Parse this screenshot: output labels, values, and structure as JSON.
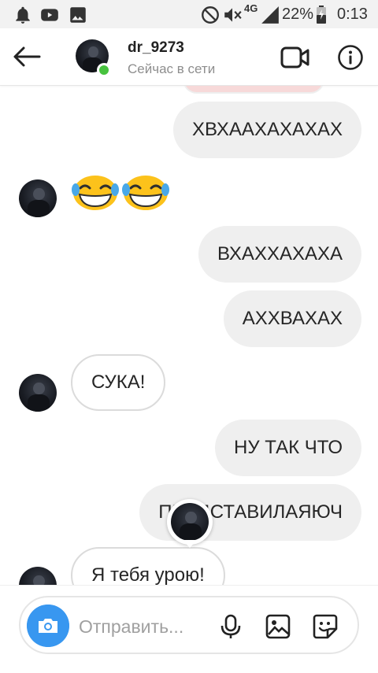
{
  "status_bar": {
    "network": "4G",
    "battery": "22%",
    "time": "0:13"
  },
  "header": {
    "username": "dr_9273",
    "presence": "Сейчас в сети"
  },
  "messages": [
    {
      "side": "out",
      "text": "ХВХААХАХАХАХ"
    },
    {
      "side": "in",
      "type": "emoji",
      "emoji": "😂😂"
    },
    {
      "side": "out",
      "text": "ВХАХХАХАХА"
    },
    {
      "side": "out",
      "text": "АХХВАХАХ"
    },
    {
      "side": "in",
      "text": "СУКА!"
    },
    {
      "side": "out",
      "text": "НУ ТАК ЧТО"
    },
    {
      "side": "out",
      "text": "ПРЕДСТАВИЛАЯЮЧ"
    },
    {
      "side": "in",
      "text": "Я тебя урою!"
    }
  ],
  "composer": {
    "placeholder": "Отправить..."
  },
  "colors": {
    "accent": "#3897f0",
    "online": "#47c23e",
    "bubble_out": "#efefef"
  },
  "icons": [
    "notification-icon",
    "youtube-icon",
    "gallery-icon",
    "dnd-icon",
    "mute-icon",
    "signal-icon",
    "battery-icon",
    "back-arrow-icon",
    "video-call-icon",
    "info-icon",
    "camera-icon",
    "microphone-icon",
    "image-icon",
    "sticker-icon"
  ]
}
